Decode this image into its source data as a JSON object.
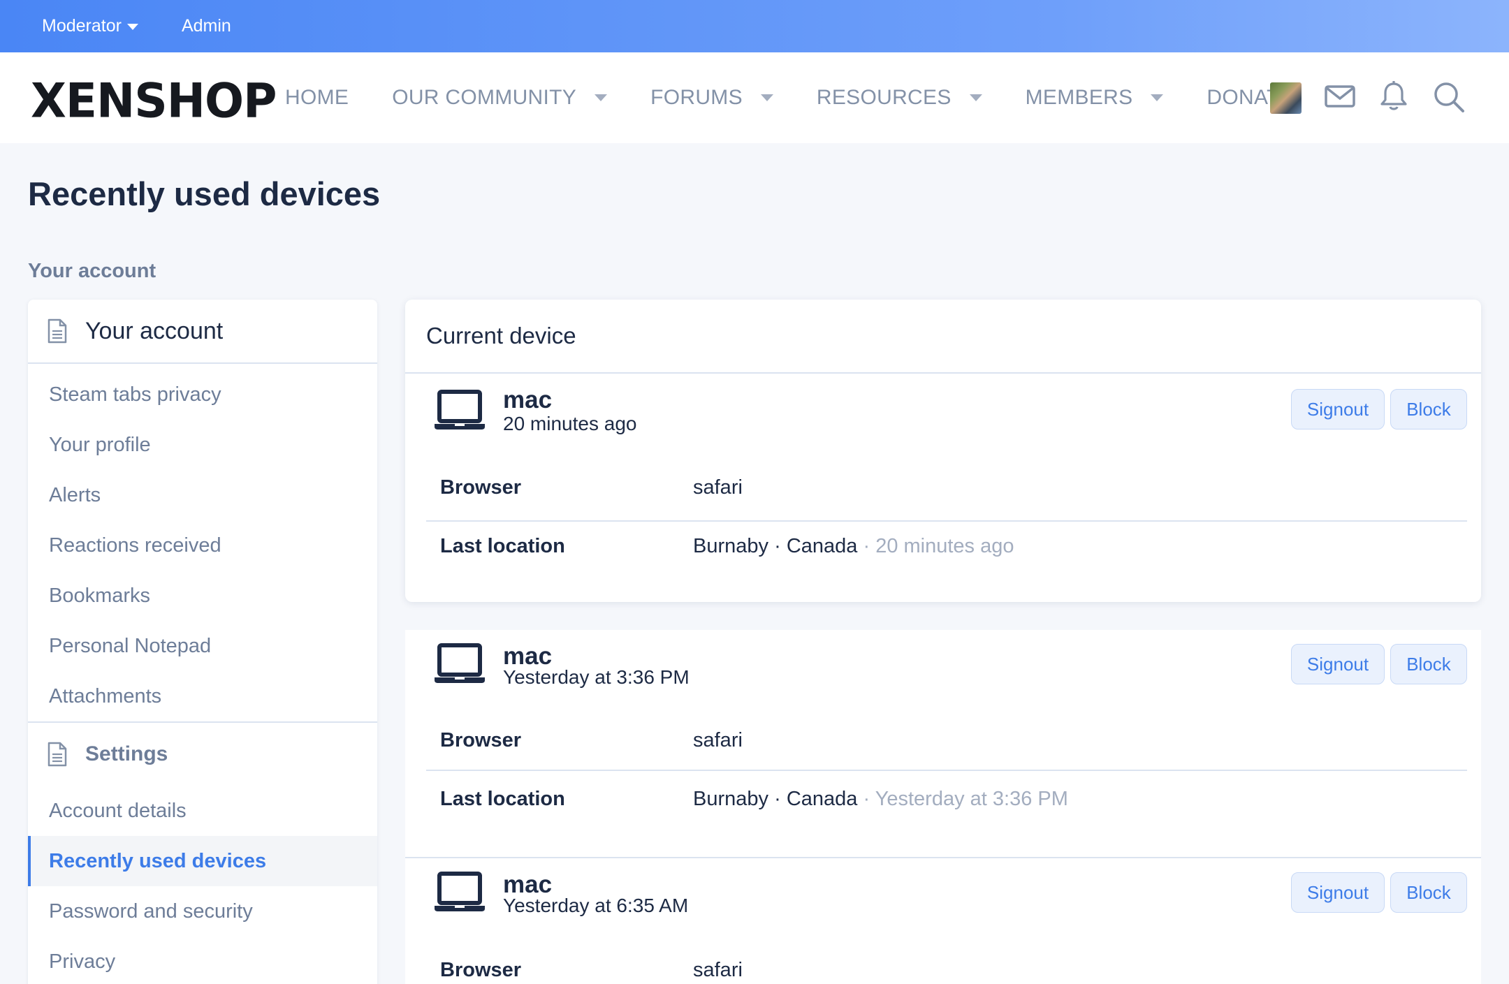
{
  "staff_bar": {
    "moderator_label": "Moderator",
    "admin_label": "Admin"
  },
  "header": {
    "logo": "XENSHOP",
    "nav": [
      {
        "label": "HOME",
        "dropdown": false
      },
      {
        "label": "OUR COMMUNITY",
        "dropdown": true
      },
      {
        "label": "FORUMS",
        "dropdown": true
      },
      {
        "label": "RESOURCES",
        "dropdown": true
      },
      {
        "label": "MEMBERS",
        "dropdown": true
      },
      {
        "label": "DONATE",
        "dropdown": false
      }
    ],
    "icons": [
      "avatar",
      "envelope-icon",
      "bell-icon",
      "search-icon"
    ]
  },
  "page": {
    "title": "Recently used devices",
    "breadcrumb": "Your account"
  },
  "sidebar": {
    "account_header": "Your account",
    "account_items": [
      "Steam tabs privacy",
      "Your profile",
      "Alerts",
      "Reactions received",
      "Bookmarks",
      "Personal Notepad",
      "Attachments"
    ],
    "settings_header": "Settings",
    "settings_items": [
      "Account details",
      "Recently used devices",
      "Password and security",
      "Privacy"
    ],
    "active_item": "Recently used devices"
  },
  "current_device": {
    "heading": "Current device"
  },
  "devices": [
    {
      "name": "mac",
      "time": "20 minutes ago",
      "signout_label": "Signout",
      "block_label": "Block",
      "browser_label": "Browser",
      "browser": "safari",
      "location_label": "Last location",
      "city": "Burnaby",
      "country": "Canada",
      "location_time": "20 minutes ago"
    },
    {
      "name": "mac",
      "time": "Yesterday at 3:36 PM",
      "signout_label": "Signout",
      "block_label": "Block",
      "browser_label": "Browser",
      "browser": "safari",
      "location_label": "Last location",
      "city": "Burnaby",
      "country": "Canada",
      "location_time": "Yesterday at 3:36 PM"
    },
    {
      "name": "mac",
      "time": "Yesterday at 6:35 AM",
      "signout_label": "Signout",
      "block_label": "Block",
      "browser_label": "Browser",
      "browser": "safari"
    }
  ],
  "separator": "·",
  "colors": {
    "accent": "#3d7ce8",
    "staff_bar": "#4a86f5",
    "text_dark": "#1d2a44",
    "text_muted": "#6d7d98"
  }
}
